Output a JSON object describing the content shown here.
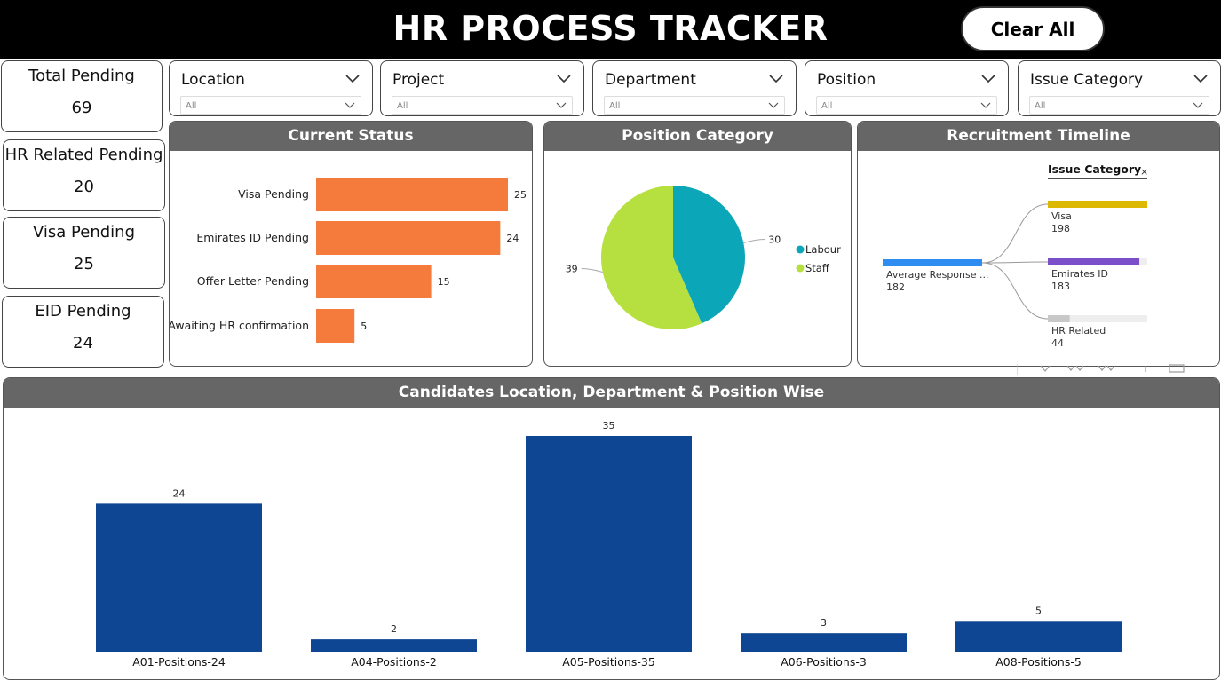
{
  "header": {
    "title": "HR PROCESS TRACKER",
    "clear_label": "Clear All"
  },
  "kpis": [
    {
      "label": "Total Pending",
      "value": "69"
    },
    {
      "label": "HR Related Pending",
      "value": "20"
    },
    {
      "label": "Visa Pending",
      "value": "25"
    },
    {
      "label": "EID Pending",
      "value": "24"
    }
  ],
  "slicers": [
    {
      "title": "Location",
      "value": "All"
    },
    {
      "title": "Project",
      "value": "All"
    },
    {
      "title": "Department",
      "value": "All"
    },
    {
      "title": "Position",
      "value": "All"
    },
    {
      "title": "Issue Category",
      "value": "All"
    }
  ],
  "current_status": {
    "title": "Current Status",
    "chart_data": {
      "type": "bar",
      "orientation": "horizontal",
      "categories": [
        "Visa Pending",
        "Emirates ID Pending",
        "Offer Letter Pending",
        "Awaiting HR confirmation"
      ],
      "values": [
        25,
        24,
        15,
        5
      ],
      "color": "#F47B3B"
    }
  },
  "position_category": {
    "title": "Position Category",
    "chart_data": {
      "type": "pie",
      "labels": [
        "Labour",
        "Staff"
      ],
      "values": [
        30,
        39
      ],
      "colors": [
        "#0BA7B8",
        "#B5E03F"
      ],
      "legend": "right"
    }
  },
  "recruitment_timeline": {
    "title": "Recruitment Timeline",
    "tree_header": "Issue Category",
    "root": {
      "label": "Average Response ...",
      "value": "182",
      "color": "#2F8CF0"
    },
    "branches": [
      {
        "label": "Visa",
        "value": "198",
        "color": "#DDB800",
        "fraction": 1.0
      },
      {
        "label": "Emirates ID",
        "value": "183",
        "color": "#7A4FC9",
        "fraction": 0.92
      },
      {
        "label": "HR Related",
        "value": "44",
        "color": "#C8C8C8",
        "fraction": 0.22
      }
    ]
  },
  "candidates": {
    "title": "Candidates Location, Department & Position Wise",
    "chart_data": {
      "type": "bar",
      "categories": [
        "A01-Positions-24",
        "A04-Positions-2",
        "A05-Positions-35",
        "A06-Positions-3",
        "A08-Positions-5"
      ],
      "values": [
        24,
        2,
        35,
        3,
        5
      ],
      "color": "#0F4693"
    }
  }
}
